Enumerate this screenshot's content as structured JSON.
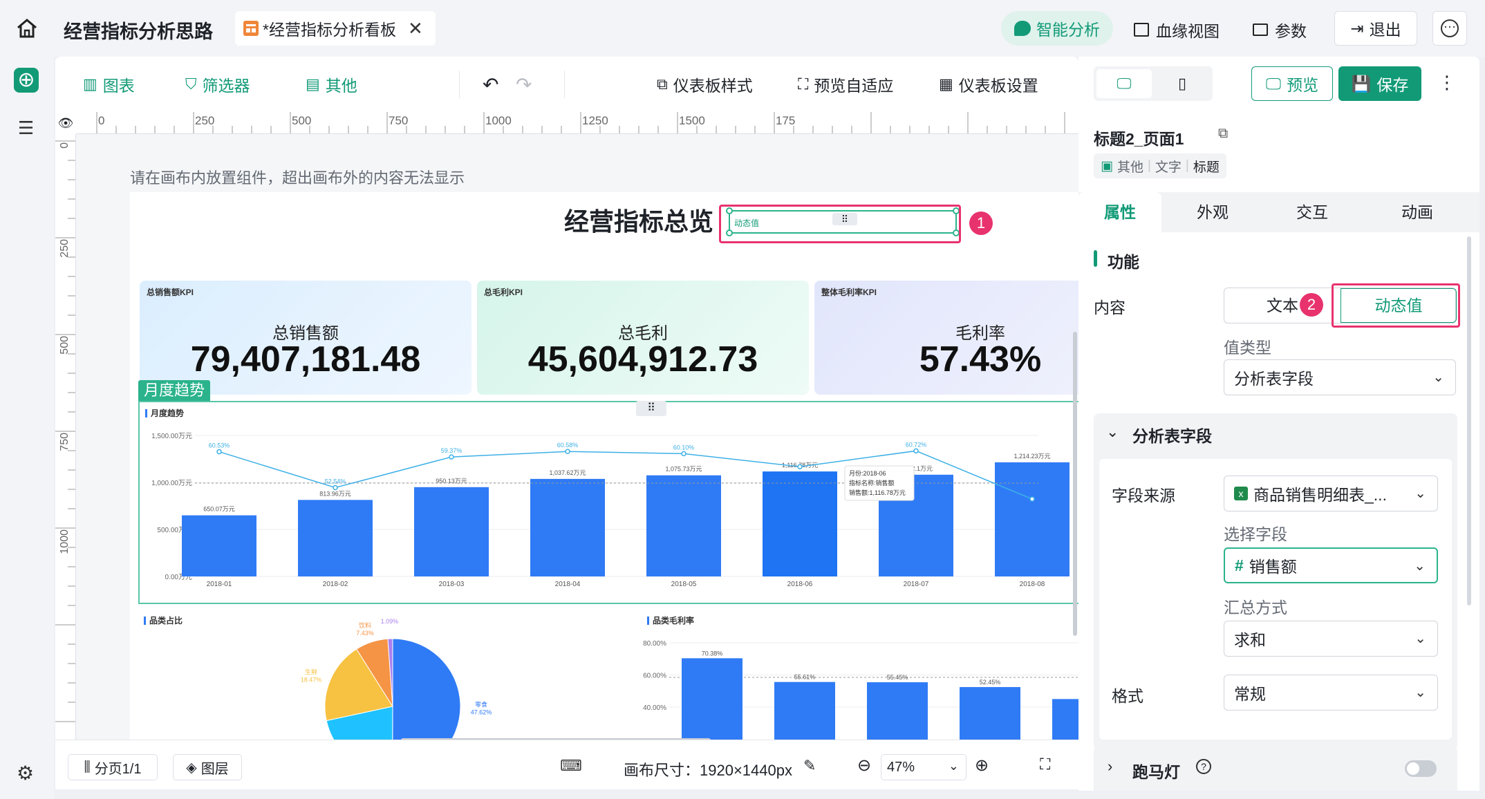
{
  "topbar": {
    "title": "经营指标分析思路",
    "tab_label": "*经营指标分析看板",
    "ai_button": "智能分析",
    "lineage_button": "血缘视图",
    "params_button": "参数",
    "exit_button": "退出"
  },
  "toolbar": {
    "chart": "图表",
    "filter": "筛选器",
    "other": "其他",
    "dashboard_style": "仪表板样式",
    "preview_adaptive": "预览自适应",
    "dashboard_settings": "仪表板设置",
    "preview": "预览",
    "save": "保存"
  },
  "ruler": {
    "top_ticks": [
      "0",
      "250",
      "500",
      "750",
      "1000",
      "1250",
      "1500",
      "175"
    ],
    "left_ticks": [
      "0",
      "250",
      "500",
      "750",
      "1000"
    ]
  },
  "canvas": {
    "hint": "请在画布内放置组件，超出画布外的内容无法显示",
    "dashboard_title": "经营指标总览",
    "dynamic_value_label": "动态值",
    "badge1": "1",
    "trend_tag": "月度趋势"
  },
  "kpis": [
    {
      "tag": "总销售额KPI",
      "label": "总销售额",
      "value": "79,407,181.48"
    },
    {
      "tag": "总毛利KPI",
      "label": "总毛利",
      "value": "45,604,912.73"
    },
    {
      "tag": "整体毛利率KPI",
      "label": "毛利率",
      "value": "57.43%"
    }
  ],
  "chart_data": [
    {
      "type": "bar",
      "title": "月度趋势",
      "categories": [
        "2018-01",
        "2018-02",
        "2018-03",
        "2018-04",
        "2018-05",
        "2018-06",
        "2018-07",
        "2018-08"
      ],
      "series": [
        {
          "values": [
            650.07,
            813.96,
            950.13,
            1037.62,
            1075.73,
            1116.78,
            1082.1,
            1214.23
          ],
          "labels": [
            "650.07万元",
            "813.96万元",
            "950.13万元",
            "1,037.62万元",
            "1,075.73万元",
            "1,116.78万元",
            "1,082.1万元",
            "1,214.23万元"
          ]
        },
        {
          "type": "line",
          "values": [
            60.53,
            52.54,
            59.37,
            60.58,
            60.1,
            57.2,
            60.72,
            50.0
          ],
          "labels": [
            "60.53%",
            "52.54%",
            "59.37%",
            "60.58%",
            "60.10%",
            "",
            "60.72%",
            ""
          ]
        }
      ],
      "y_ticks": [
        "1,500.00万元",
        "1,000.00万元",
        "500.00万元",
        "0.00万元"
      ],
      "ylim": [
        0,
        1500
      ],
      "tooltip": {
        "line1": "月份:2018-06",
        "line2": "指标名称:销售额",
        "line3": "销售额:1,116.78万元"
      }
    },
    {
      "type": "pie",
      "title": "品类占比",
      "slices": [
        {
          "name": "零食",
          "value": 47.62,
          "label": "零食\n47.62%",
          "color": "#2f7bf5"
        },
        {
          "name": "",
          "value": 20.5,
          "color": "#1fc2ff"
        },
        {
          "name": "生鲜",
          "value": 18.47,
          "label": "生鲜\n18.47%",
          "color": "#f7c242"
        },
        {
          "name": "饮料",
          "value": 7.43,
          "label": "饮料\n7.43%",
          "color": "#f59445"
        },
        {
          "name": "",
          "value": 1.09,
          "label": "1.09%",
          "color": "#a980f0"
        }
      ]
    },
    {
      "type": "bar",
      "title": "品类毛利率",
      "values": [
        70.38,
        55.61,
        55.45,
        52.45,
        45.0
      ],
      "labels": [
        "70.38%",
        "55.61%",
        "55.45%",
        "52.45%",
        ""
      ],
      "y_ticks": [
        "80.00%",
        "60.00%",
        "40.00%"
      ],
      "ylim": [
        0,
        80
      ]
    }
  ],
  "bottombar": {
    "page": "分页1/1",
    "layers": "图层",
    "canvas_size": "画布尺寸：1920×1440px",
    "zoom": "47%"
  },
  "panel": {
    "component_name": "标题2_页面1",
    "crumb1": "其他",
    "crumb2": "文字",
    "crumb3": "标题",
    "tabs": [
      "属性",
      "外观",
      "交互",
      "动画"
    ],
    "section_function": "功能",
    "content_label": "内容",
    "content_text": "文本",
    "content_dynamic": "动态值",
    "badge2": "2",
    "value_type_label": "值类型",
    "value_type": "分析表字段",
    "section_field": "分析表字段",
    "field_source_label": "字段来源",
    "field_source": "商品销售明细表_...",
    "choose_field_label": "选择字段",
    "field": "销售额",
    "agg_label": "汇总方式",
    "agg": "求和",
    "format_label": "格式",
    "format": "常规",
    "marquee": "跑马灯"
  },
  "colors": {
    "accent": "#129a77",
    "highlight": "#e8326e",
    "bar": "#2f7bf5"
  }
}
